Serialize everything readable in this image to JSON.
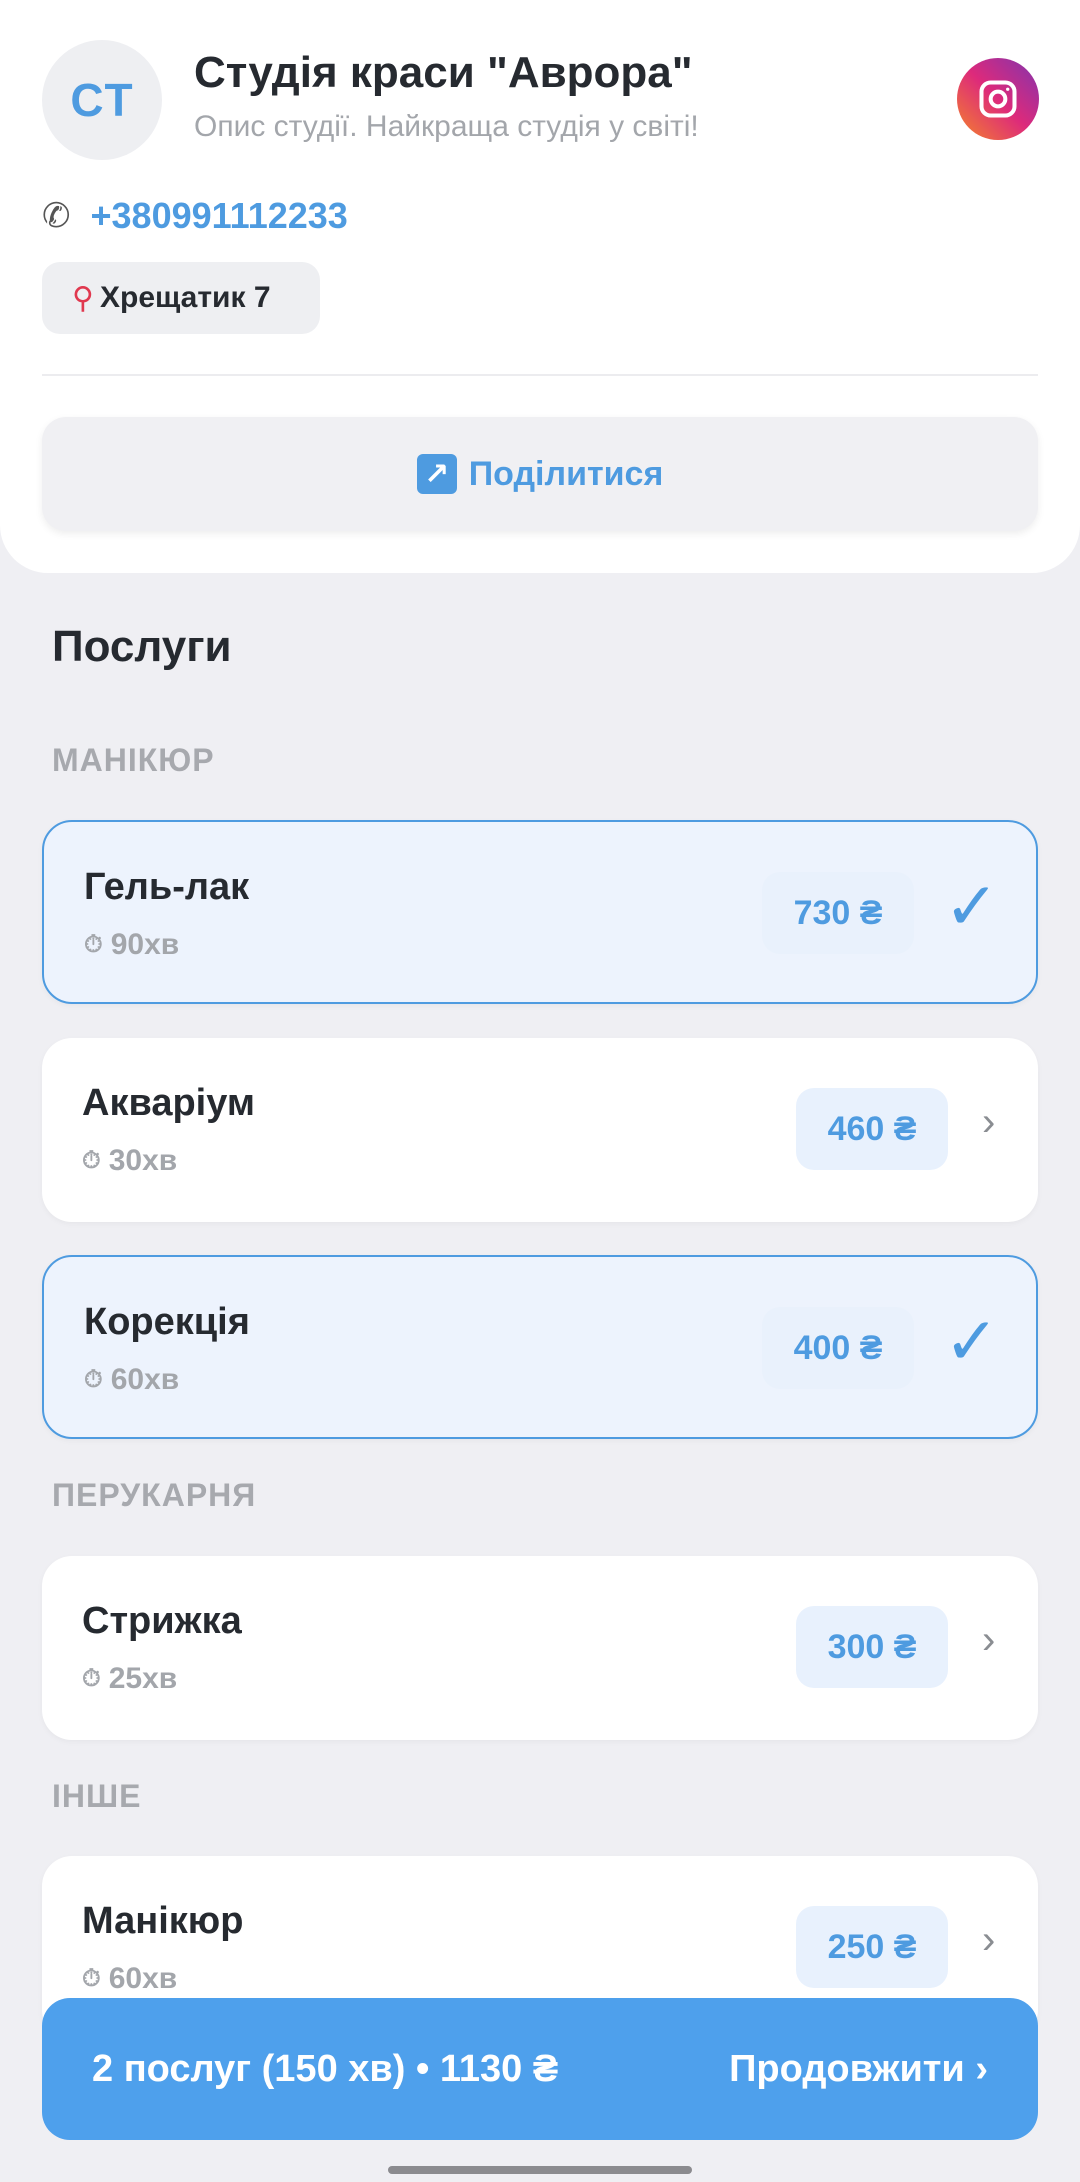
{
  "studio": {
    "initials": "CT",
    "name": "Студія краси \"Аврора\"",
    "description": "Опис студії. Найкраща студія у світі!",
    "phone": "+380991112233",
    "address": "Хрещатик 7",
    "share_label": "Поділитися"
  },
  "icons": {
    "phone": "phone-icon",
    "pin": "pin-icon",
    "share": "share-icon",
    "instagram": "instagram-icon",
    "timer": "timer-icon",
    "check": "check-icon",
    "chevron": "chevron-right-icon"
  },
  "services_title": "Послуги",
  "categories": [
    {
      "label": "МАНІКЮР",
      "services": [
        {
          "name": "Гель-лак",
          "duration": "90хв",
          "price": "730 ₴",
          "selected": true
        },
        {
          "name": "Акваріум",
          "duration": "30хв",
          "price": "460 ₴",
          "selected": false
        },
        {
          "name": "Корекція",
          "duration": "60хв",
          "price": "400 ₴",
          "selected": true
        }
      ]
    },
    {
      "label": "ПЕРУКАРНЯ",
      "services": [
        {
          "name": "Стрижка",
          "duration": "25хв",
          "price": "300 ₴",
          "selected": false
        }
      ]
    },
    {
      "label": "ІНШЕ",
      "services": [
        {
          "name": "Манікюр",
          "duration": "60хв",
          "price": "250 ₴",
          "selected": false
        }
      ]
    }
  ],
  "cta": {
    "summary": "2 послуг (150 хв) • 1130 ₴",
    "action": "Продовжити ›"
  },
  "colors": {
    "accent": "#4e9be0",
    "background": "#efeff3",
    "selected_bg": "#edf3fd"
  }
}
